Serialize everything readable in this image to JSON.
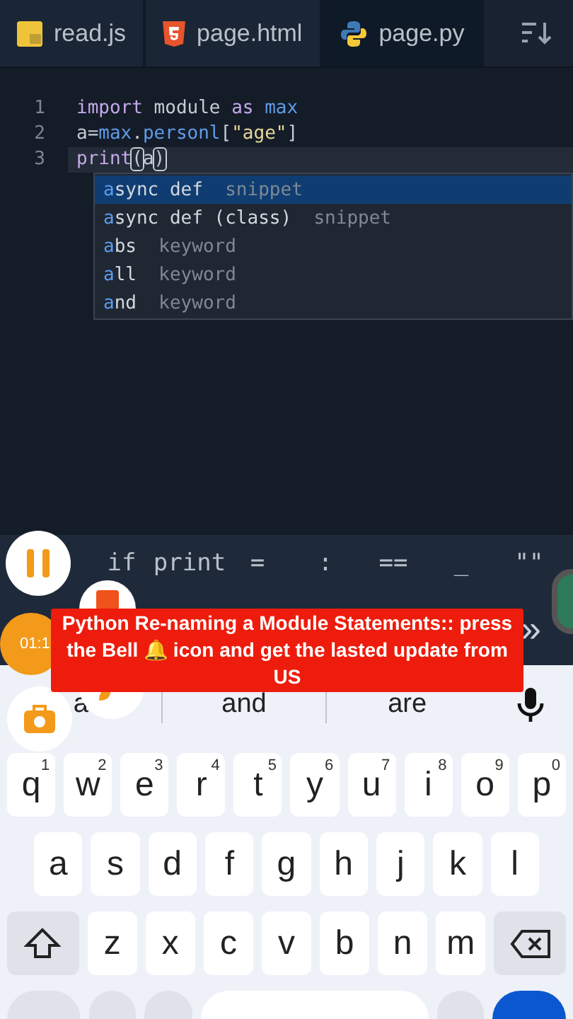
{
  "tabs": [
    {
      "label": "read.js",
      "selected": false
    },
    {
      "label": "page.html",
      "selected": false
    },
    {
      "label": "page.py",
      "selected": true
    }
  ],
  "code_lines": [
    {
      "number": "1",
      "tokens": [
        {
          "text": "import",
          "kind": "keyword"
        },
        {
          "text": " module ",
          "kind": "plain"
        },
        {
          "text": "as",
          "kind": "keyword"
        },
        {
          "text": " max",
          "kind": "name"
        }
      ]
    },
    {
      "number": "2",
      "tokens": [
        {
          "text": "a=",
          "kind": "plain"
        },
        {
          "text": "max",
          "kind": "name"
        },
        {
          "text": ".",
          "kind": "plain"
        },
        {
          "text": "personl",
          "kind": "name"
        },
        {
          "text": "[",
          "kind": "plain"
        },
        {
          "text": "\"age\"",
          "kind": "string"
        },
        {
          "text": "]",
          "kind": "plain"
        }
      ]
    },
    {
      "number": "3",
      "current": true,
      "tokens": [
        {
          "text": "print",
          "kind": "keyword"
        },
        {
          "text": "(",
          "kind": "bracket"
        },
        {
          "text": "a",
          "kind": "plain"
        },
        {
          "text": ")",
          "kind": "bracket"
        }
      ]
    }
  ],
  "autocomplete": [
    {
      "match": "a",
      "rest": "sync def",
      "detail": "snippet",
      "selected": true
    },
    {
      "match": "a",
      "rest": "sync def (class)",
      "detail": "snippet",
      "selected": false
    },
    {
      "match": "a",
      "rest": "bs",
      "detail": "keyword",
      "selected": false
    },
    {
      "match": "a",
      "rest": "ll",
      "detail": "keyword",
      "selected": false
    },
    {
      "match": "a",
      "rest": "nd",
      "detail": "keyword",
      "selected": false
    }
  ],
  "symbols": [
    "if",
    "print",
    "=",
    ":",
    "==",
    "_",
    "\"\""
  ],
  "recorder": {
    "timer": "01:1"
  },
  "caption": "Python Re-naming a Module Statements:: press the Bell 🔔 icon and get the lasted update from US",
  "more_symbols": "»",
  "suggestions": [
    "a",
    "and",
    "are"
  ],
  "keyboard": [
    [
      {
        "label": "q",
        "hint": "1"
      },
      {
        "label": "w",
        "hint": "2"
      },
      {
        "label": "e",
        "hint": "3"
      },
      {
        "label": "r",
        "hint": "4"
      },
      {
        "label": "t",
        "hint": "5"
      },
      {
        "label": "y",
        "hint": "6"
      },
      {
        "label": "u",
        "hint": "7"
      },
      {
        "label": "i",
        "hint": "8"
      },
      {
        "label": "o",
        "hint": "9"
      },
      {
        "label": "p",
        "hint": "0"
      }
    ],
    [
      {
        "label": "a"
      },
      {
        "label": "s"
      },
      {
        "label": "d"
      },
      {
        "label": "f"
      },
      {
        "label": "g"
      },
      {
        "label": "h"
      },
      {
        "label": "j"
      },
      {
        "label": "k"
      },
      {
        "label": "l"
      }
    ],
    [
      {
        "kind": "shift"
      },
      {
        "label": "z"
      },
      {
        "label": "x"
      },
      {
        "label": "c"
      },
      {
        "label": "v"
      },
      {
        "label": "b"
      },
      {
        "label": "n"
      },
      {
        "label": "m"
      },
      {
        "kind": "backspace"
      }
    ]
  ]
}
